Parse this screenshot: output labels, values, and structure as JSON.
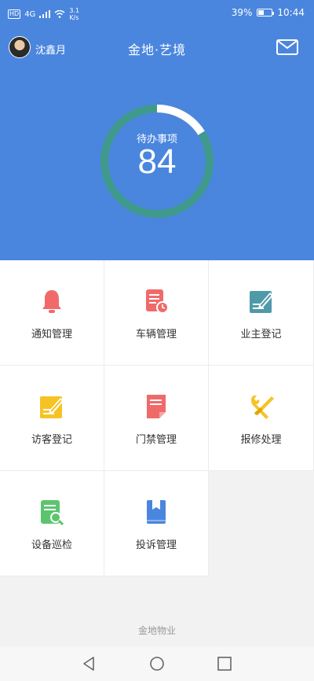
{
  "status_bar": {
    "hd": "HD",
    "net": "4G",
    "speed_value": "3.1",
    "speed_unit": "K/s",
    "battery": "39%",
    "time": "10:44"
  },
  "header": {
    "username": "沈鑫月",
    "title": "金地·艺境",
    "mail_icon": "mail-icon",
    "pending_label": "待办事项",
    "pending_count": "84",
    "pending_progress": 0.16,
    "bg_color": "#4a86de",
    "ring_color": "#3f9a8c"
  },
  "menu": [
    {
      "label": "通知管理",
      "icon": "bell-icon",
      "color": "#f06a6a"
    },
    {
      "label": "车辆管理",
      "icon": "document-clock-icon",
      "color": "#f06a6a"
    },
    {
      "label": "业主登记",
      "icon": "edit-icon",
      "color": "#4f9aa8"
    },
    {
      "label": "访客登记",
      "icon": "edit-icon",
      "color": "#f5c325"
    },
    {
      "label": "门禁管理",
      "icon": "document-icon",
      "color": "#f06a6a"
    },
    {
      "label": "报修处理",
      "icon": "wrench-screwdriver-icon",
      "color": "#f5c325"
    },
    {
      "label": "设备巡检",
      "icon": "document-search-icon",
      "color": "#5dc46e"
    },
    {
      "label": "投诉管理",
      "icon": "book-icon",
      "color": "#4a86de"
    }
  ],
  "footer": {
    "company": "金地物业"
  },
  "nav": {
    "back_icon": "back-icon",
    "home_icon": "home-icon",
    "recents_icon": "recents-icon"
  }
}
